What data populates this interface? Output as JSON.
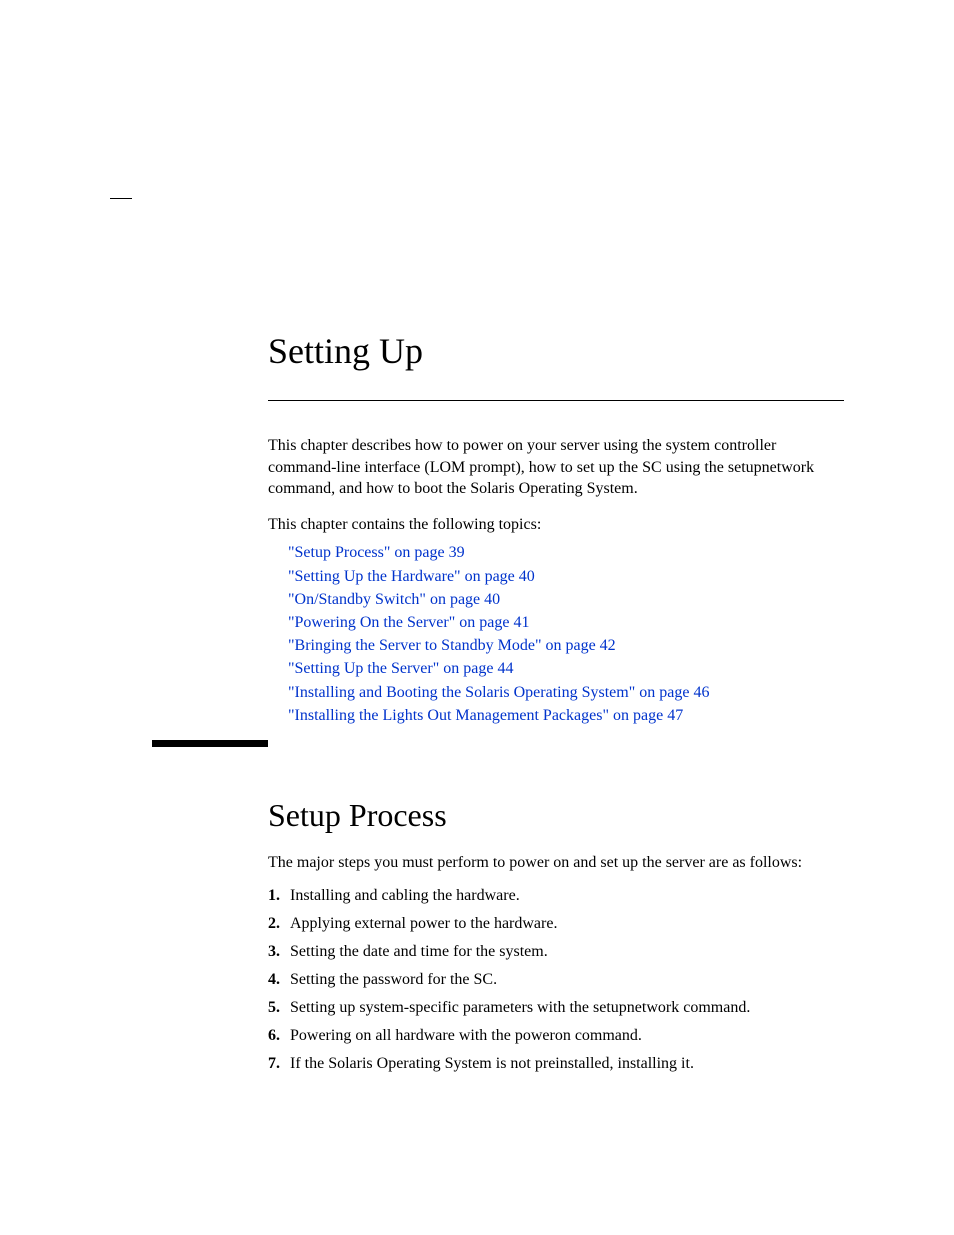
{
  "chapter": {
    "title": "Setting Up"
  },
  "intro": {
    "paragraph": "This chapter describes how to power on your server using the system controller command-line interface (LOM prompt), how to set up the SC using the setupnetwork command, and how to boot the Solaris Operating System.",
    "topics_lead": "This chapter contains the following topics:"
  },
  "toc": [
    {
      "text": "\"Setup Process\" on page 39"
    },
    {
      "text": "\"Setting Up the Hardware\" on page 40"
    },
    {
      "text": "\"On/Standby Switch\" on page 40"
    },
    {
      "text": "\"Powering On the Server\" on page 41"
    },
    {
      "text": "\"Bringing the Server to Standby Mode\" on page 42"
    },
    {
      "text": "\"Setting Up the Server\" on page 44"
    },
    {
      "text": "\"Installing and Booting the Solaris Operating System\" on page 46"
    },
    {
      "text": "\"Installing the Lights Out Management Packages\" on page 47"
    }
  ],
  "section": {
    "heading": "Setup Process",
    "intro": "The major steps you must perform to power on and set up the server are as follows:"
  },
  "steps": [
    {
      "num": "1.",
      "text": "Installing and cabling the hardware."
    },
    {
      "num": "2.",
      "text": "Applying external power to the hardware."
    },
    {
      "num": "3.",
      "text": "Setting the date and time for the system."
    },
    {
      "num": "4.",
      "text": "Setting the password for the SC."
    },
    {
      "num": "5.",
      "text": "Setting up system-specific parameters with the setupnetwork command."
    },
    {
      "num": "6.",
      "text": "Powering on all hardware with the poweron command."
    },
    {
      "num": "7.",
      "text": "If the Solaris Operating System is not preinstalled, installing it."
    }
  ]
}
